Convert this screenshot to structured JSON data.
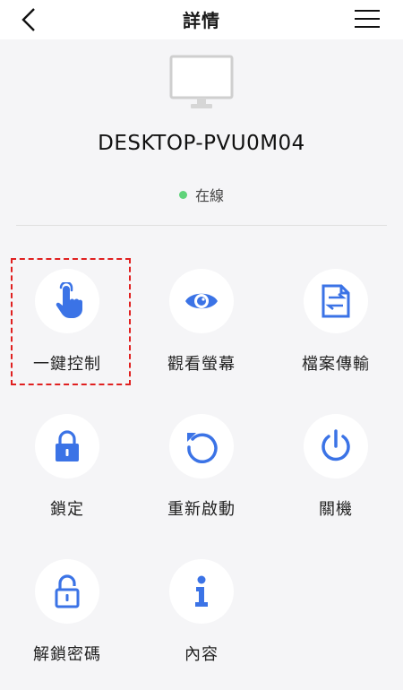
{
  "header": {
    "title": "詳情",
    "back_icon": "chevron-left-icon",
    "menu_icon": "hamburger-menu-icon"
  },
  "device": {
    "icon": "monitor-icon",
    "name": "DESKTOP-PVU0M04",
    "status_text": "在線",
    "status_color": "#5fd37a"
  },
  "actions": [
    {
      "label": "一鍵控制",
      "icon": "touch-hand-icon"
    },
    {
      "label": "觀看螢幕",
      "icon": "eye-icon"
    },
    {
      "label": "檔案傳輸",
      "icon": "file-transfer-icon"
    },
    {
      "label": "鎖定",
      "icon": "lock-icon"
    },
    {
      "label": "重新啟動",
      "icon": "restart-icon"
    },
    {
      "label": "關機",
      "icon": "power-icon"
    },
    {
      "label": "解鎖密碼",
      "icon": "unlock-icon"
    },
    {
      "label": "內容",
      "icon": "info-icon"
    }
  ],
  "colors": {
    "accent": "#3b73e6",
    "highlight_border": "#e02020",
    "background": "#f5f5f7"
  }
}
